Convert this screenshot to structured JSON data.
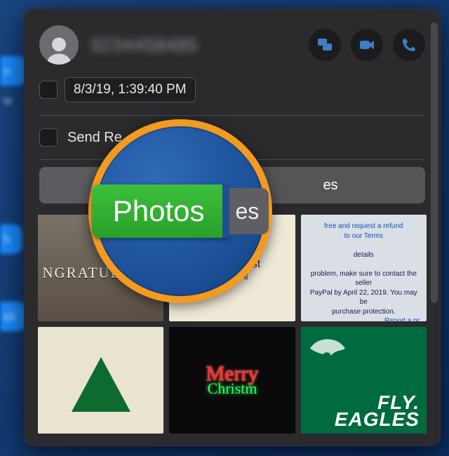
{
  "bg_bubbles": {
    "b1": "o w",
    "b2": "h",
    "b3": "ali"
  },
  "contact": {
    "name": "3234458485"
  },
  "actions": {
    "screenshare": "screenshare-icon",
    "facetime_video": "video-camera-icon",
    "facetime_audio": "phone-icon"
  },
  "options": {
    "timestamp": "8/3/19, 1:39:40 PM",
    "send_read_label": "Send Re"
  },
  "tabs": {
    "photos_label": "Photos",
    "other_fragment": "es"
  },
  "thumbs": {
    "t1": "NGRATULATIC",
    "t2_line1": "January 1st",
    "t2_line2": "Greeting",
    "t3_a": "free and request a refund",
    "t3_b": "to our Terms",
    "t3_c": "details",
    "t3_d": "problem, make sure to contact the seller",
    "t3_e": "PayPal by April 22, 2019. You may be",
    "t3_f": "purchase protection.",
    "t3_link": "Report a pr",
    "t5_a": "Merry",
    "t5_b": "Christm",
    "t6_a": "FLY.",
    "t6_b": "EAGLES"
  },
  "magnifier": {
    "pill_label": "Photos",
    "side_fragment": "es"
  }
}
